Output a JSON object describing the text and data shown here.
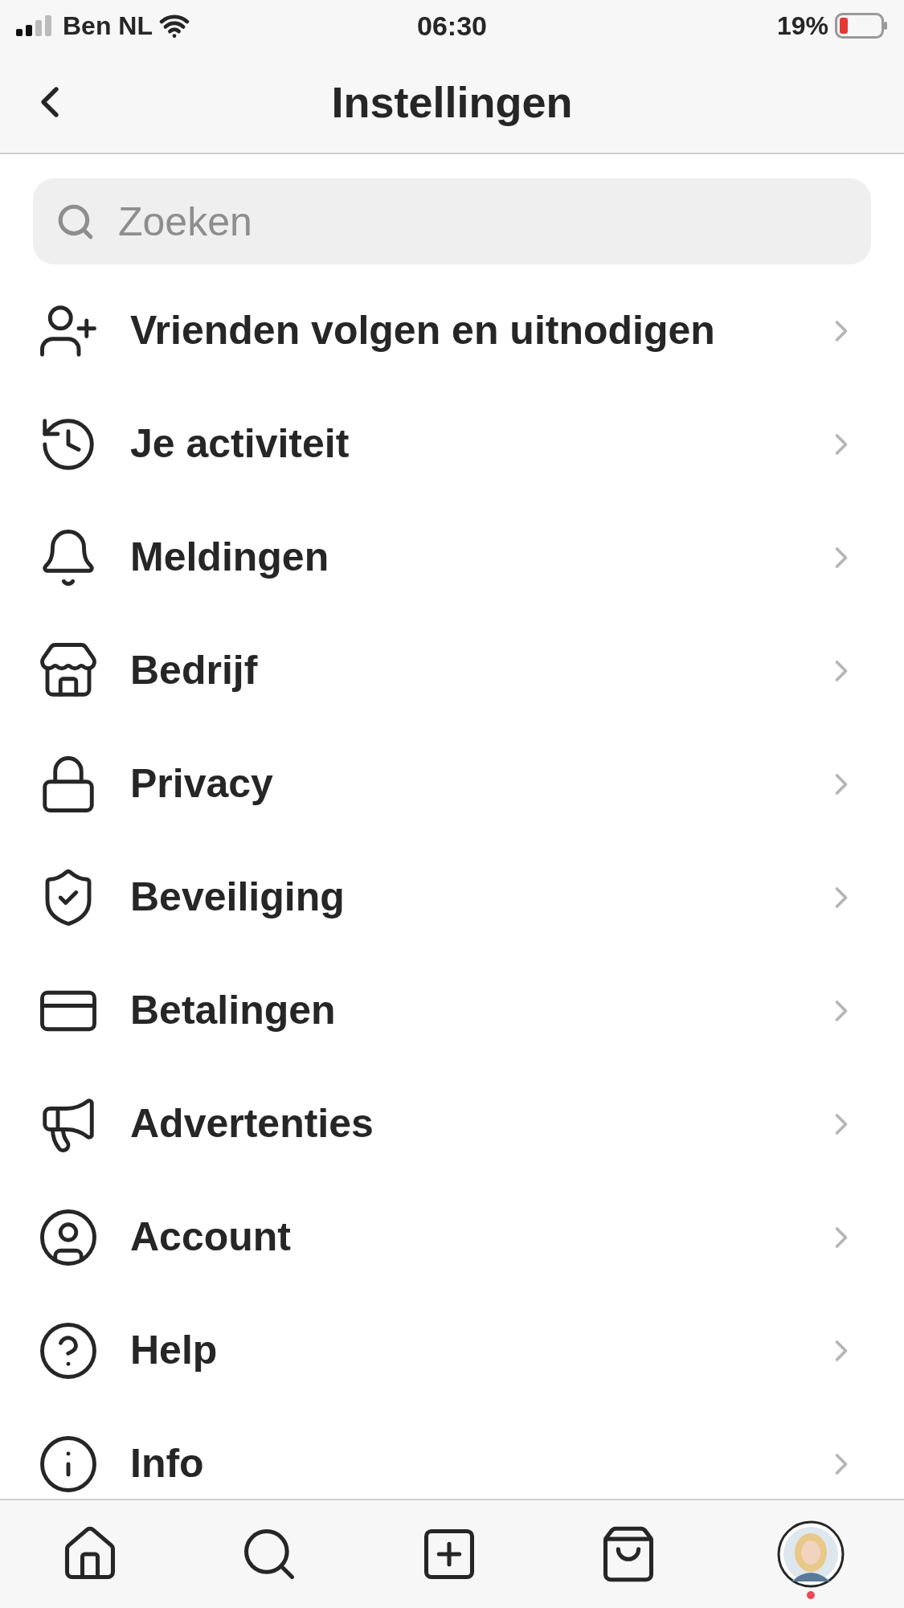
{
  "status_bar": {
    "carrier": "Ben NL",
    "time": "06:30",
    "battery": "19%"
  },
  "header": {
    "title": "Instellingen"
  },
  "search": {
    "placeholder": "Zoeken"
  },
  "items": [
    {
      "label": "Vrienden volgen en uitnodigen"
    },
    {
      "label": "Je activiteit"
    },
    {
      "label": "Meldingen"
    },
    {
      "label": "Bedrijf"
    },
    {
      "label": "Privacy"
    },
    {
      "label": "Beveiliging"
    },
    {
      "label": "Betalingen"
    },
    {
      "label": "Advertenties"
    },
    {
      "label": "Account"
    },
    {
      "label": "Help"
    },
    {
      "label": "Info"
    }
  ],
  "tab_bar": [
    {
      "kind": "home"
    },
    {
      "kind": "search"
    },
    {
      "kind": "create"
    },
    {
      "kind": "shop"
    },
    {
      "kind": "profile",
      "badge": true
    }
  ]
}
